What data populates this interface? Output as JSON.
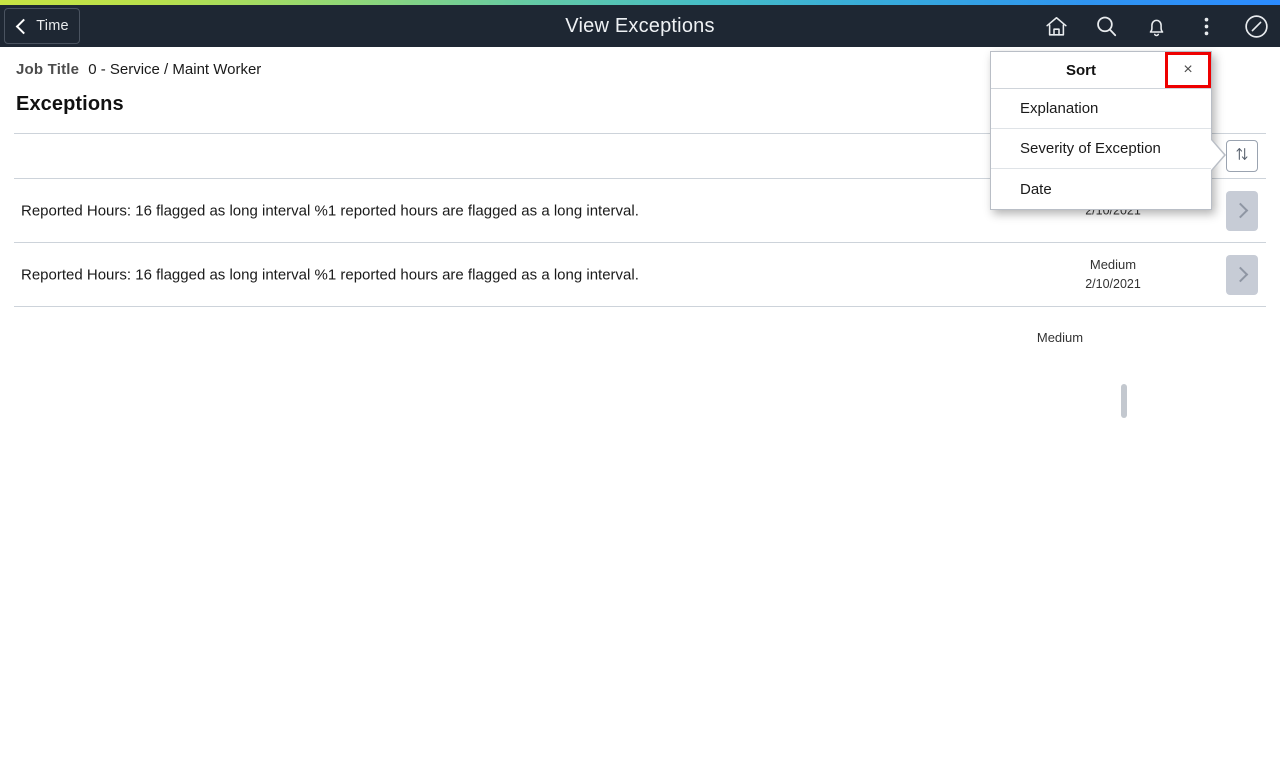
{
  "header": {
    "back_label": "Time",
    "back_icon": "chevron-left-icon",
    "title": "View Exceptions",
    "icons": [
      {
        "name": "home-icon",
        "label": "Home"
      },
      {
        "name": "search-icon",
        "label": "Search"
      },
      {
        "name": "bell-icon",
        "label": "Notifications"
      },
      {
        "name": "kebab-menu-icon",
        "label": "Actions"
      },
      {
        "name": "navbar-compass-icon",
        "label": "NavBar"
      }
    ],
    "accent_strip": {
      "from": "#c9e544",
      "mid": "#46bdc6",
      "to": "#2b8bff"
    },
    "background": "#1e2733"
  },
  "page": {
    "job_title_label": "Job Title",
    "job_title_value": "0 - Service / Maint Worker",
    "heading": "Exceptions"
  },
  "list": {
    "sort_toggle_icon": "sort-updown-icon",
    "chevron_icon": "chevron-right-icon",
    "rows": [
      {
        "text": "",
        "severity": "",
        "date": "",
        "has_chevron": false,
        "has_sort_toggle": true
      },
      {
        "text": "Reported Hours: 16 flagged as long interval  %1 reported hours are flagged as a long interval.",
        "severity": "",
        "date": "2/10/2021",
        "has_chevron": true,
        "has_sort_toggle": false
      },
      {
        "text": "Reported Hours: 16 flagged as long interval  %1 reported hours are flagged as a long interval.",
        "severity": "Medium",
        "date": "2/10/2021",
        "has_chevron": true,
        "has_sort_toggle": false
      },
      {
        "text": "",
        "severity": "Medium",
        "date": "",
        "has_chevron": false,
        "has_sort_toggle": false
      }
    ]
  },
  "sort_panel": {
    "title": "Sort",
    "close_label": "×",
    "close_highlight_color": "#ee0000",
    "options": [
      {
        "label": "Explanation"
      },
      {
        "label": "Severity of Exception"
      },
      {
        "label": "Date"
      }
    ]
  }
}
